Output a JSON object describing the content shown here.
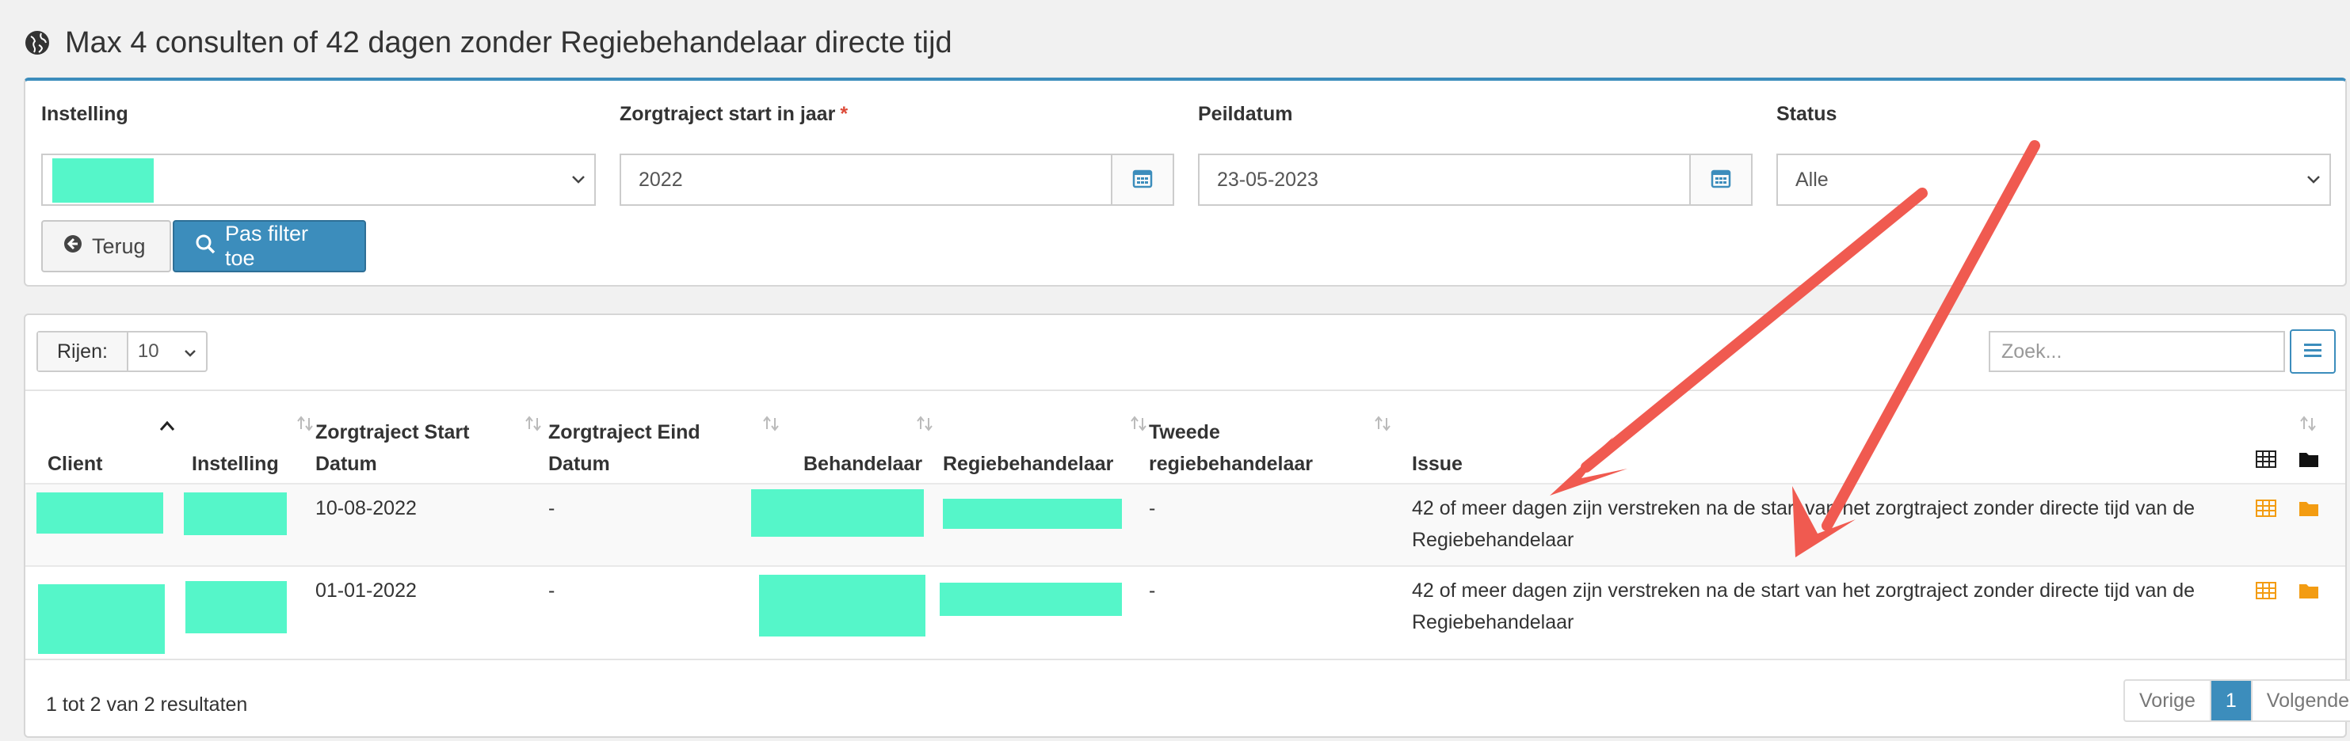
{
  "page": {
    "title": "Max 4 consulten of 42 dagen zonder Regiebehandelaar directe tijd"
  },
  "filters": {
    "instelling": {
      "label": "Instelling",
      "value": ""
    },
    "zorgtraject": {
      "label": "Zorgtraject start in jaar",
      "required": "*",
      "value": "2022"
    },
    "peildatum": {
      "label": "Peildatum",
      "value": "23-05-2023"
    },
    "status": {
      "label": "Status",
      "value": "Alle"
    }
  },
  "buttons": {
    "back": "Terug",
    "apply": "Pas filter toe"
  },
  "table_controls": {
    "rows_label": "Rijen:",
    "rows_value": "10",
    "search_placeholder": "Zoek..."
  },
  "table": {
    "headers": {
      "client": "Client",
      "instelling": "Instelling",
      "start_1": "Zorgtraject Start",
      "start_2": "Datum",
      "eind_1": "Zorgtraject Eind",
      "eind_2": "Datum",
      "behandelaar": "Behandelaar",
      "regie": "Regiebehandelaar",
      "tweede_1": "Tweede",
      "tweede_2": "regiebehandelaar",
      "issue": "Issue"
    },
    "rows": [
      {
        "start": "10-08-2022",
        "eind": "-",
        "tweede": "-",
        "issue_1": "42 of meer dagen zijn verstreken na de start van het zorgtraject zonder directe tijd van de",
        "issue_2": "Regiebehandelaar"
      },
      {
        "start": "01-01-2022",
        "eind": "-",
        "tweede": "-",
        "issue_1": "42 of meer dagen zijn verstreken na de start van het zorgtraject zonder directe tijd van de",
        "issue_2": "Regiebehandelaar"
      }
    ]
  },
  "footer": {
    "info": "1 tot 2 van 2 resultaten",
    "prev": "Vorige",
    "page": "1",
    "next": "Volgende"
  },
  "colors": {
    "primary": "#3c8dbc",
    "redaction": "#55f6c9",
    "annotation_arrow": "#f05a50",
    "icon_orange": "#f39c12"
  }
}
